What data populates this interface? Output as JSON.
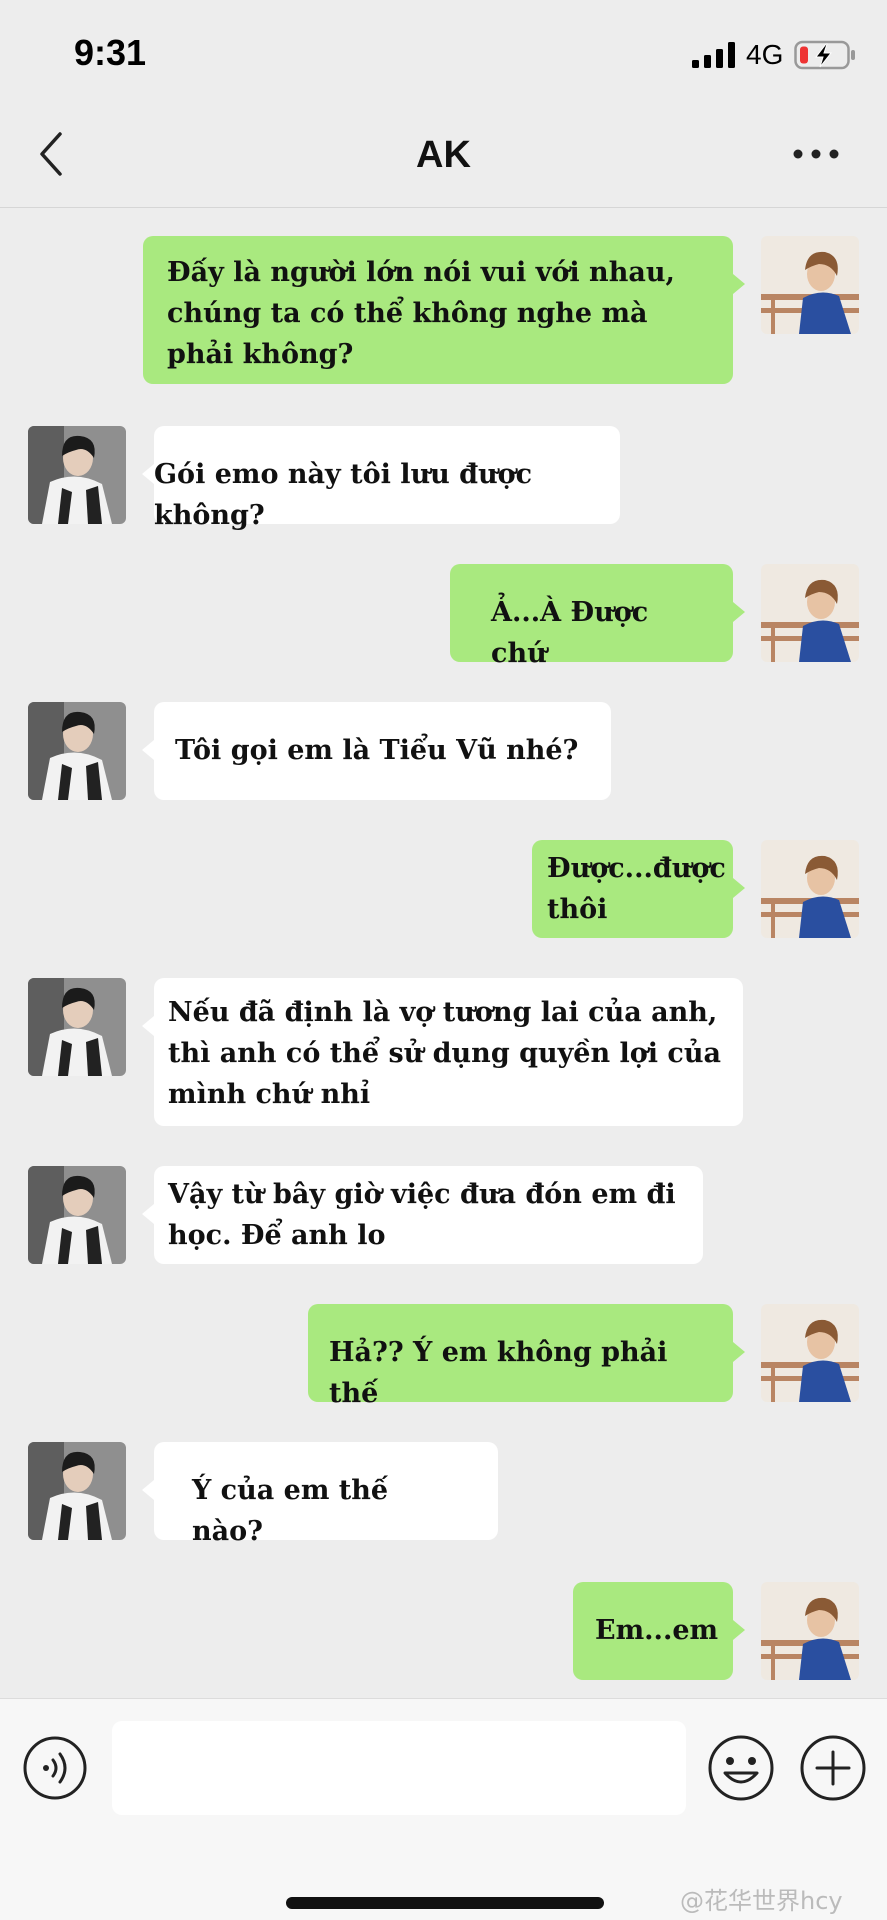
{
  "status": {
    "time": "9:31",
    "network": "4G"
  },
  "header": {
    "title": "AK"
  },
  "messages": [
    {
      "from": "me",
      "text": "Đấy là người lớn nói vui với nhau, chúng ta có thể không nghe mà phải không?"
    },
    {
      "from": "other",
      "text": "Gói emo này tôi lưu được không?"
    },
    {
      "from": "me",
      "text": "Ả...À Được chứ"
    },
    {
      "from": "other",
      "text": "Tôi gọi em là Tiểu Vũ nhé?"
    },
    {
      "from": "me",
      "text": "Được...được thôi"
    },
    {
      "from": "other",
      "text": "Nếu đã định là vợ tương lai của anh, thì anh có thể sử dụng quyền lợi của mình chứ nhỉ"
    },
    {
      "from": "other",
      "text": "Vậy từ bây giờ việc đưa đón em đi học. Để anh lo"
    },
    {
      "from": "me",
      "text": "Hả?? Ý em không phải thế"
    },
    {
      "from": "other",
      "text": "Ý của em thế nào?"
    },
    {
      "from": "me",
      "text": "Em...em"
    }
  ],
  "input": {
    "value": "",
    "placeholder": ""
  },
  "icons": {
    "back": "chevron-left-icon",
    "more": "more-dots-icon",
    "voice": "voice-icon",
    "emoji": "emoji-icon",
    "plus": "plus-icon"
  },
  "colors": {
    "my_bubble": "#a9e97f",
    "other_bubble": "#ffffff",
    "background": "#ededed"
  },
  "watermark": "@花华世界hcy"
}
